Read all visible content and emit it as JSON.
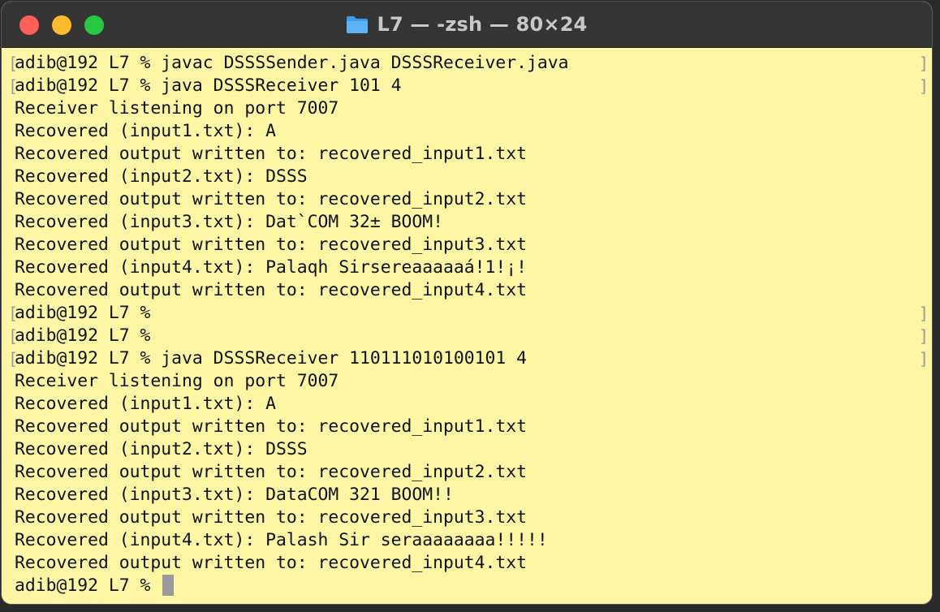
{
  "window": {
    "title": "L7 — -zsh — 80×24"
  },
  "terminal": {
    "lines": [
      {
        "text": "adib@192 L7 % javac DSSSSender.java DSSSReceiver.java",
        "bracket": true
      },
      {
        "text": "adib@192 L7 % java DSSSReceiver 101 4",
        "bracket": true
      },
      {
        "text": "Receiver listening on port 7007",
        "bracket": false
      },
      {
        "text": "Recovered (input1.txt): A",
        "bracket": false
      },
      {
        "text": "Recovered output written to: recovered_input1.txt",
        "bracket": false
      },
      {
        "text": "Recovered (input2.txt): DSSS",
        "bracket": false
      },
      {
        "text": "Recovered output written to: recovered_input2.txt",
        "bracket": false
      },
      {
        "text": "Recovered (input3.txt): Dat`COM 32± BOOM!",
        "bracket": false
      },
      {
        "text": "Recovered output written to: recovered_input3.txt",
        "bracket": false
      },
      {
        "text": "Recovered (input4.txt): Palaqh Sirsereaaaaaá!1!¡!",
        "bracket": false
      },
      {
        "text": "Recovered output written to: recovered_input4.txt",
        "bracket": false
      },
      {
        "text": "adib@192 L7 %",
        "bracket": true
      },
      {
        "text": "adib@192 L7 %",
        "bracket": true
      },
      {
        "text": "adib@192 L7 % java DSSSReceiver 110111010100101 4",
        "bracket": true
      },
      {
        "text": "Receiver listening on port 7007",
        "bracket": false
      },
      {
        "text": "Recovered (input1.txt): A",
        "bracket": false
      },
      {
        "text": "Recovered output written to: recovered_input1.txt",
        "bracket": false
      },
      {
        "text": "Recovered (input2.txt): DSSS",
        "bracket": false
      },
      {
        "text": "Recovered output written to: recovered_input2.txt",
        "bracket": false
      },
      {
        "text": "Recovered (input3.txt): DataCOM 321 BOOM!!",
        "bracket": false
      },
      {
        "text": "Recovered output written to: recovered_input3.txt",
        "bracket": false
      },
      {
        "text": "Recovered (input4.txt): Palash Sir seraaaaaaaa!!!!!",
        "bracket": false
      },
      {
        "text": "Recovered output written to: recovered_input4.txt",
        "bracket": false
      }
    ],
    "prompt": "adib@192 L7 % "
  },
  "colors": {
    "background": "#fdf6a4",
    "titlebar": "#353535",
    "close": "#fe5f57",
    "minimize": "#febc2e",
    "zoom": "#28c840"
  },
  "icons": {
    "title": "folder-icon"
  }
}
